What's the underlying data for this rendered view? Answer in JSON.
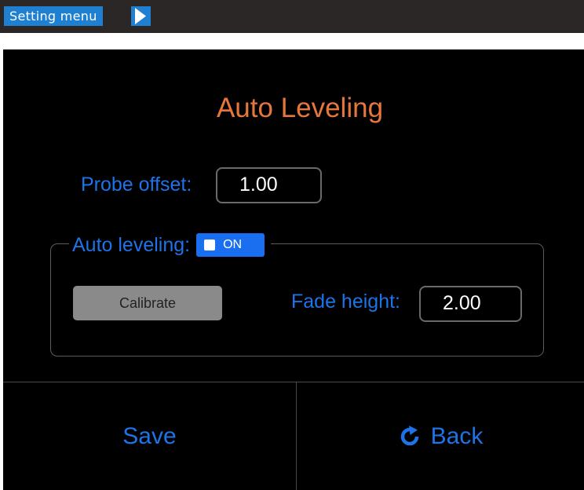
{
  "breadcrumb": {
    "label": "Setting menu"
  },
  "screen": {
    "title": "Auto Leveling",
    "probe_offset": {
      "label": "Probe offset:",
      "value": "1.00"
    },
    "auto_leveling": {
      "label": "Auto leveling:",
      "toggle_text": "ON",
      "enabled": true,
      "calibrate_label": "Calibrate",
      "fade_height": {
        "label": "Fade height:",
        "value": "2.00"
      }
    }
  },
  "footer": {
    "save_label": "Save",
    "back_label": "Back",
    "back_icon": "refresh-icon"
  },
  "colors": {
    "title": "#e6773c",
    "label": "#1d73e8",
    "toggle": "#1a6ff0",
    "breadcrumb": "#1f7fd0"
  }
}
